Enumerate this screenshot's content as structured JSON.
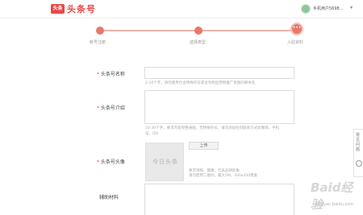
{
  "header": {
    "logo_badge": "头条",
    "logo_text": "头条号",
    "user_name": "手机用户5698...",
    "caret": "▾"
  },
  "steps": [
    {
      "label": "帐号注册"
    },
    {
      "label": "选择类型"
    },
    {
      "label": "入驻资料",
      "dots": "•••"
    }
  ],
  "form": {
    "name": {
      "required": "*",
      "label": "头条号名称",
      "value": "",
      "hint": "2-10个字，请勿使用包含特殊符号或含有明显营销推广意图的媒体名"
    },
    "intro": {
      "required": "*",
      "label": "头条号介绍",
      "value": "",
      "hint_line1": "10-30个字，要求内容完整通顺，无特殊符号，请勿添加任何联系方式如微博、手机",
      "hint_line2": "号、QQ"
    },
    "avatar": {
      "required": "*",
      "label": "头条号头像",
      "placeholder": "今日头条",
      "upload_label": "上传",
      "hint_line1": "要求清晰、健康，代表品牌形象",
      "hint_line2": "请勿使用二维码，最大5M，200x200像素"
    },
    "materials": {
      "label": "辅助材料",
      "value": ""
    }
  },
  "side_tab": {
    "text": "常见问题"
  },
  "watermark": {
    "main": "Baid经验",
    "sub": "jingyan.baidu.com"
  },
  "colors": {
    "brand": "#e84848",
    "progress": "#e8786a"
  }
}
